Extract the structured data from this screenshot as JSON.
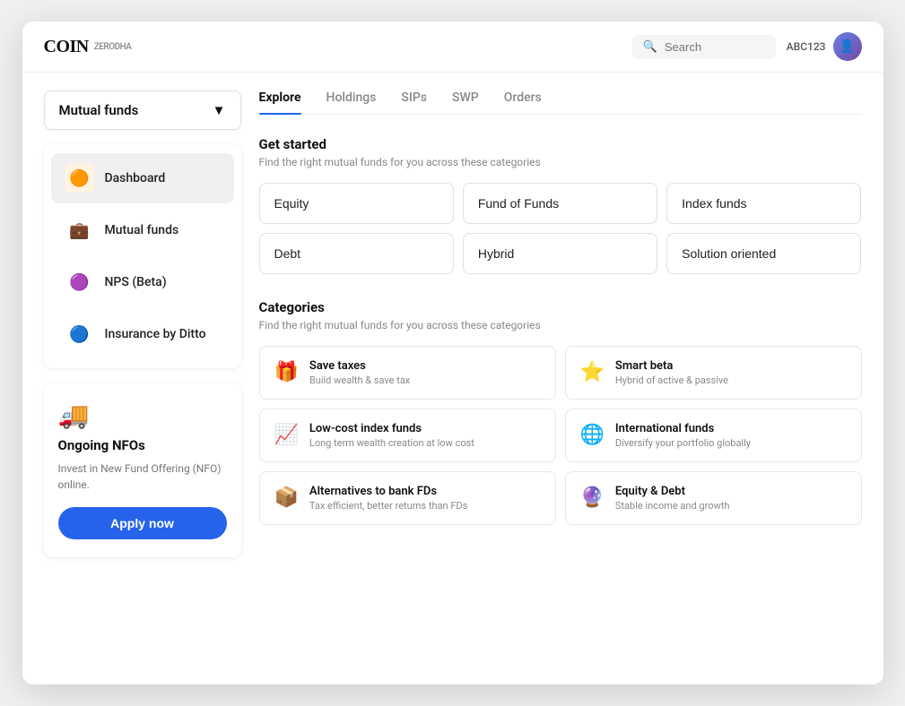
{
  "header": {
    "logo_text": "COIN",
    "logo_sub": "ZERODHA",
    "search_placeholder": "Search",
    "user_id": "ABC123"
  },
  "sidebar": {
    "dropdown_label": "Mutual funds",
    "nav_items": [
      {
        "id": "dashboard",
        "label": "Dashboard",
        "icon": "🟠"
      },
      {
        "id": "mutual-funds",
        "label": "Mutual funds",
        "icon": "💼"
      },
      {
        "id": "nps",
        "label": "NPS (Beta)",
        "icon": "🟣"
      },
      {
        "id": "insurance",
        "label": "Insurance by Ditto",
        "icon": "🔵"
      }
    ],
    "nfo": {
      "icon": "🚚",
      "title": "Ongoing NFOs",
      "desc": "Invest in New Fund Offering (NFO) online.",
      "btn_label": "Apply now"
    }
  },
  "content": {
    "tabs": [
      {
        "id": "explore",
        "label": "Explore",
        "active": true
      },
      {
        "id": "holdings",
        "label": "Holdings",
        "active": false
      },
      {
        "id": "sips",
        "label": "SIPs",
        "active": false
      },
      {
        "id": "swp",
        "label": "SWP",
        "active": false
      },
      {
        "id": "orders",
        "label": "Orders",
        "active": false
      }
    ],
    "get_started": {
      "title": "Get started",
      "desc": "Find the right mutual funds for you across these categories"
    },
    "fund_types": [
      {
        "id": "equity",
        "label": "Equity"
      },
      {
        "id": "fund-of-funds",
        "label": "Fund of Funds"
      },
      {
        "id": "index-funds",
        "label": "Index funds"
      },
      {
        "id": "debt",
        "label": "Debt"
      },
      {
        "id": "hybrid",
        "label": "Hybrid"
      },
      {
        "id": "solution-oriented",
        "label": "Solution oriented"
      }
    ],
    "categories": {
      "title": "Categories",
      "desc": "Find the right mutual funds for you across these categories",
      "items": [
        {
          "id": "save-taxes",
          "icon": "🎁",
          "title": "Save taxes",
          "desc": "Build wealth & save tax"
        },
        {
          "id": "smart-beta",
          "icon": "⭐",
          "title": "Smart beta",
          "desc": "Hybrid of active & passive"
        },
        {
          "id": "low-cost-index",
          "icon": "📈",
          "title": "Low-cost index funds",
          "desc": "Long term wealth creation at low cost"
        },
        {
          "id": "international",
          "icon": "🌐",
          "title": "International funds",
          "desc": "Diversify your portfolio globally"
        },
        {
          "id": "alternatives-fd",
          "icon": "📦",
          "title": "Alternatives to bank FDs",
          "desc": "Tax efficient, better returns than FDs"
        },
        {
          "id": "equity-debt",
          "icon": "🔮",
          "title": "Equity & Debt",
          "desc": "Stable income and growth"
        }
      ]
    }
  }
}
